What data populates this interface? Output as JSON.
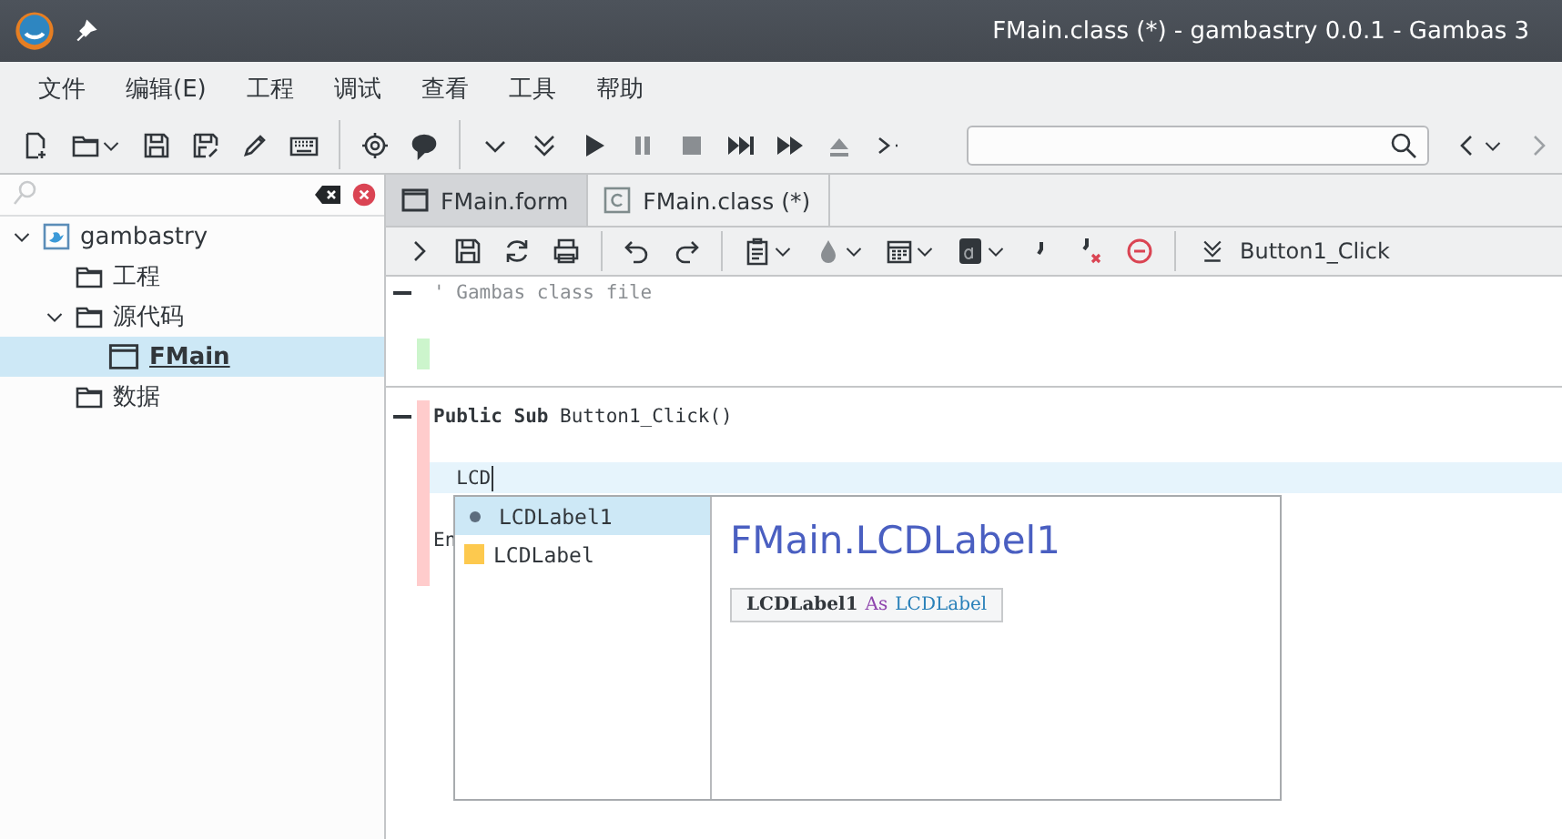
{
  "window": {
    "title": "FMain.class (*) - gambastry 0.0.1 - Gambas 3"
  },
  "menu": [
    {
      "label": "文件"
    },
    {
      "label": "编辑(E)"
    },
    {
      "label": "工程"
    },
    {
      "label": "调试"
    },
    {
      "label": "查看"
    },
    {
      "label": "工具"
    },
    {
      "label": "帮助"
    }
  ],
  "sidebar": {
    "tree": [
      {
        "label": "gambastry",
        "kind": "project",
        "selected": false,
        "expanded": true,
        "children": [
          {
            "label": "工程",
            "kind": "folder",
            "selected": false
          },
          {
            "label": "源代码",
            "kind": "folder",
            "selected": false,
            "expanded": true,
            "children": [
              {
                "label": "FMain",
                "kind": "form",
                "selected": true
              }
            ]
          },
          {
            "label": "数据",
            "kind": "folder",
            "selected": false
          }
        ]
      }
    ]
  },
  "tabs": [
    {
      "label": "FMain.form",
      "kind": "form",
      "selected": false
    },
    {
      "label": "FMain.class (*)",
      "kind": "class",
      "selected": true
    }
  ],
  "editor": {
    "procedure": "Button1_Click",
    "blocks": [
      {
        "lines": [
          {
            "text": "' Gambas class file",
            "kind": "comment"
          },
          {
            "kind": "blank"
          },
          {
            "kind": "blank",
            "color": "#ccf5cc"
          }
        ]
      },
      {
        "lines": [
          {
            "text": "**Public Sub** Button1_Click()",
            "kind": "code",
            "color": "#ffcccc"
          },
          {
            "kind": "blank",
            "color": "#ffcccc"
          },
          {
            "text": "  LCD",
            "kind": "code",
            "color": "#ffcccc",
            "current": true
          },
          {
            "kind": "blank",
            "color": "#ffcccc"
          },
          {
            "text": "En",
            "kind": "code",
            "color": "#ffcccc"
          },
          {
            "kind": "blank",
            "color": "#ffcccc"
          }
        ]
      }
    ]
  },
  "completion": {
    "items": [
      {
        "label": "LCDLabel1",
        "kind": "control",
        "selected": true
      },
      {
        "label": "LCDLabel",
        "kind": "class",
        "selected": false
      }
    ],
    "detail": {
      "title": "FMain.LCDLabel1",
      "name": "LCDLabel1",
      "keyword": "As",
      "type": "LCDLabel"
    }
  }
}
